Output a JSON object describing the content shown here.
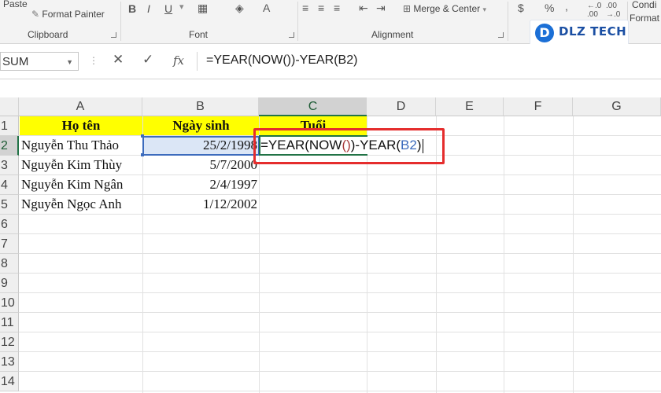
{
  "ribbon": {
    "paste_label": "Paste",
    "format_painter_label": "Format Painter",
    "clipboard_group": "Clipboard",
    "font_group": "Font",
    "alignment_group": "Alignment",
    "merge_center_label": "Merge & Center",
    "number_format_currency": "$",
    "number_format_percent": "%",
    "conditional_label": "Condi",
    "format_label": "Format",
    "bold": "B",
    "italic": "I",
    "underline": "U",
    "font_color": "A",
    "comma": ","
  },
  "logo": {
    "text": "DLZ TECH",
    "mark": "D"
  },
  "formula_bar": {
    "name_box": "SUM",
    "fx": "fx",
    "cancel": "✕",
    "enter": "✓",
    "formula": "=YEAR(NOW())-YEAR(B2)"
  },
  "columns": [
    "A",
    "B",
    "C",
    "D",
    "E",
    "F",
    "G"
  ],
  "rows": [
    "1",
    "2",
    "3",
    "4",
    "5",
    "6",
    "7",
    "8",
    "9",
    "10",
    "11",
    "12",
    "13",
    "14"
  ],
  "headers": {
    "name": "Họ tên",
    "dob": "Ngày sinh",
    "age": "Tuổi"
  },
  "data": [
    {
      "name": "Nguyễn Thu Thảo",
      "dob": "25/2/1998"
    },
    {
      "name": "Nguyễn Kim Thùy",
      "dob": "5/7/2000"
    },
    {
      "name": "Nguyễn Kim Ngân",
      "dob": "2/4/1997"
    },
    {
      "name": "Nguyễn Ngọc Anh",
      "dob": "1/12/2002"
    }
  ],
  "editing": {
    "part1": "=YEAR(NOW",
    "paren1": "()",
    "part2": ")-YEAR(",
    "ref": "B2",
    "part3": ")"
  },
  "colors": {
    "header_fill": "#ffff00",
    "highlight_border": "#e52d2d",
    "excel_green": "#217346",
    "ref_blue": "#3c6bbd"
  }
}
